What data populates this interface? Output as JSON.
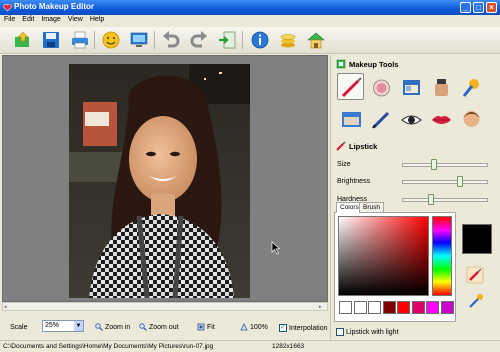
{
  "window": {
    "title": "Photo Makeup Editor"
  },
  "menu": [
    "File",
    "Edit",
    "Image",
    "View",
    "Help"
  ],
  "panel": {
    "tools_title": "Makeup Tools",
    "lipstick_title": "Lipstick",
    "sliders": [
      {
        "label": "Size",
        "value": 0.35
      },
      {
        "label": "Brightness",
        "value": 0.68
      },
      {
        "label": "Hardness",
        "value": 0.31
      }
    ],
    "tabs": [
      "Colors",
      "Brush"
    ],
    "swatches": [
      "#ffffff",
      "#ffffff",
      "#ffffff",
      "#800000",
      "#ff0000",
      "#e0006c",
      "#ff00ff",
      "#cc00cc"
    ],
    "current_color": "#000000",
    "lipstick_with_light": "Lipstick with light"
  },
  "zoombar": {
    "scale_label": "Scale",
    "scale_value": "25%",
    "zoom_in": "Zoom in",
    "zoom_out": "Zoom out",
    "fit": "Fit",
    "hundred": "100%",
    "interpolation": "Interpolation"
  },
  "status": {
    "path": "C:\\Documents and Settings\\Home\\My Documents\\My Pictures\\run-07.jpg",
    "dims": "1282x1663"
  }
}
